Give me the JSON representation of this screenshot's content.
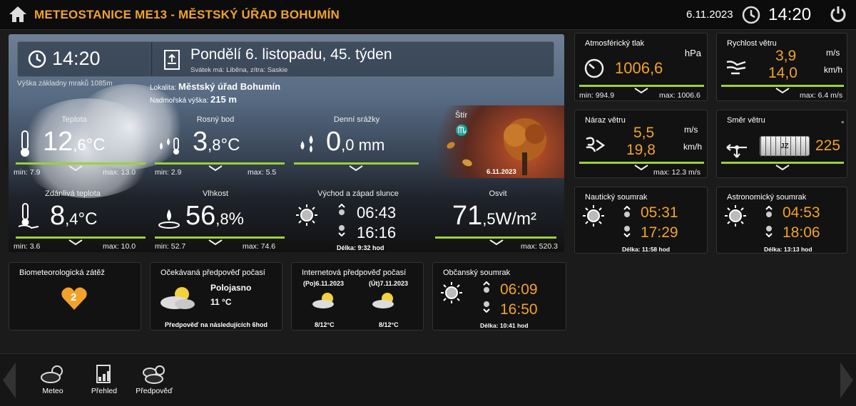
{
  "topbar": {
    "title": "METEOSTANICE ME13 - MĚSTSKÝ ÚŘAD BOHUMÍN",
    "date": "6.11.2023",
    "time": "14:20"
  },
  "main": {
    "time": "14:20",
    "cloud_base": "Výška základny mraků 1085m",
    "day_title": "Pondělí 6. listopadu, 45. týden",
    "nameday": "Svátek má: Liběna, zítra: Saskie",
    "location_label": "Lokalita:",
    "location": "Městský úřad Bohumín",
    "altitude_label": "Nadmořská výška:",
    "altitude": "215 m",
    "temp": {
      "label": "Teplota",
      "int": "12",
      "dec": ",6",
      "unit": "°C",
      "min": "min: 7.9",
      "max": "max: 13.0"
    },
    "dew": {
      "label": "Rosný bod",
      "int": "3",
      "dec": ",8",
      "unit": "°C",
      "min": "min: 2.9",
      "max": "max: 5.5"
    },
    "rain": {
      "label": "Denní srážky",
      "int": "0",
      "dec": ",0",
      "unit": "mm"
    },
    "zodiac": {
      "label": "Štír",
      "date": "6.11.2023"
    },
    "feels": {
      "label": "Zdánlivá teplota",
      "int": "8",
      "dec": ",4",
      "unit": "°C",
      "min": "min: 3.6",
      "max": "max: 10.0"
    },
    "humidity": {
      "label": "Vlhkost",
      "int": "56",
      "dec": ",8",
      "unit": "%",
      "min": "min: 52.7",
      "max": "max: 74.6"
    },
    "sun": {
      "label": "Východ a západ slunce",
      "rise": "06:43",
      "set": "16:16",
      "length": "Délka: 9:32 hod"
    },
    "solar": {
      "label": "Osvit",
      "int": "71",
      "dec": ",5",
      "unit": "W/m²",
      "max": "max: 520.3"
    }
  },
  "tiles": {
    "pressure": {
      "label": "Atmosférický tlak",
      "value": "1006,6",
      "unit": "hPa",
      "min": "min: 994.9",
      "max": "max: 1006.6"
    },
    "wind": {
      "label": "Rychlost větru",
      "v1": "3,9",
      "v2": "14,0",
      "u1": "m/s",
      "u2": "km/h",
      "max": "max: 6.4 m/s"
    },
    "gust": {
      "label": "Náraz větru",
      "v1": "5,5",
      "v2": "19,8",
      "u1": "m/s",
      "u2": "km/h",
      "max": "max: 12.3 m/s"
    },
    "direction": {
      "label": "Směr větru",
      "value": "225",
      "deg": "°",
      "compass": "JZ"
    },
    "nautical": {
      "label": "Nautický soumrak",
      "rise": "05:31",
      "set": "17:29",
      "length": "Délka: 11:58 hod"
    },
    "astro": {
      "label": "Astronomický soumrak",
      "rise": "04:53",
      "set": "18:06",
      "length": "Délka: 13:13 hod"
    },
    "bio": {
      "label": "Biometeorologická zátěž",
      "value": "2"
    },
    "forecast": {
      "label": "Očekávaná předpověď počasí",
      "desc": "Polojasno",
      "temp": "11 °C",
      "note": "Předpověď na následujících 6hod"
    },
    "inet": {
      "label": "Internetová předpověď počasí",
      "d1": "(Po)6.11.2023",
      "d2": "(Út)7.11.2023",
      "t1": "8/12°C",
      "t2": "8/12°C"
    },
    "civil": {
      "label": "Občanský soumrak",
      "rise": "06:09",
      "set": "16:50",
      "length": "Délka: 10:41 hod"
    }
  },
  "footer": {
    "meteo": "Meteo",
    "overview": "Přehled",
    "forecast": "Předpověď"
  },
  "colors": {
    "accent": "#f2a22a",
    "bar": "#9bd236"
  }
}
